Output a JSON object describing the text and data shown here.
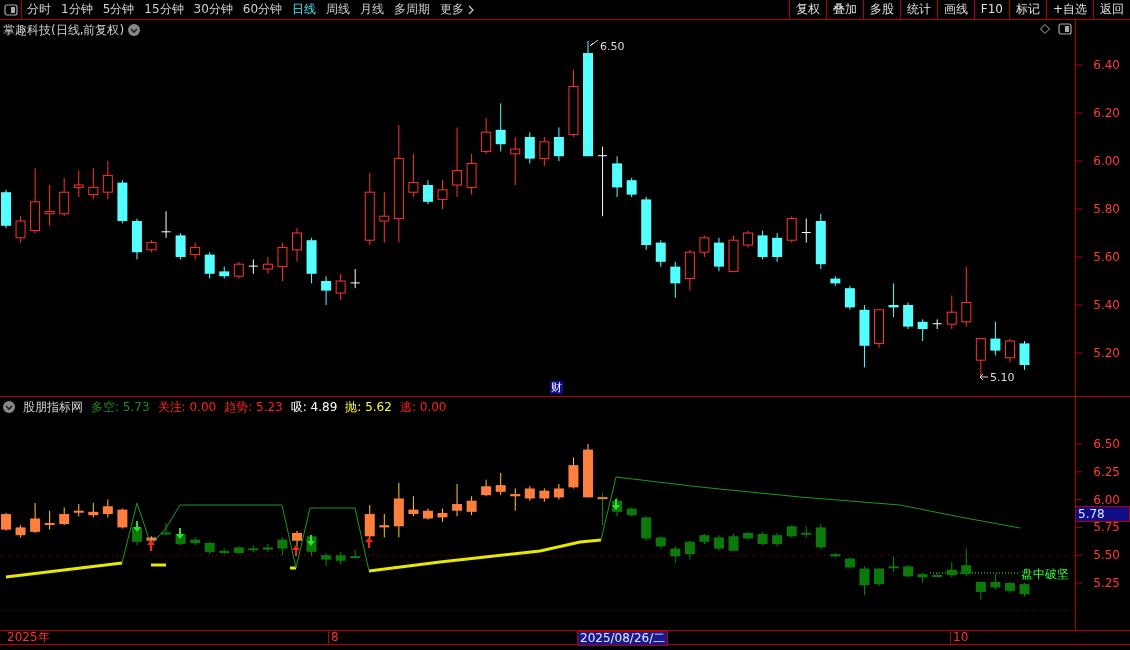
{
  "toolbar": {
    "periods": [
      {
        "label": "分时",
        "selected": false
      },
      {
        "label": "1分钟",
        "selected": false
      },
      {
        "label": "5分钟",
        "selected": false
      },
      {
        "label": "15分钟",
        "selected": false
      },
      {
        "label": "30分钟",
        "selected": false
      },
      {
        "label": "60分钟",
        "selected": false
      },
      {
        "label": "日线",
        "selected": true
      },
      {
        "label": "周线",
        "selected": false
      },
      {
        "label": "月线",
        "selected": false
      },
      {
        "label": "多周期",
        "selected": false
      },
      {
        "label": "更多",
        "selected": false
      }
    ],
    "actions": [
      "复权",
      "叠加",
      "多股",
      "统计",
      "画线",
      "F10",
      "标记",
      "+自选",
      "返回"
    ]
  },
  "main_chart": {
    "title": "掌趣科技(日线,前复权)",
    "high_label": "6.50",
    "low_label": "5.10",
    "event_marker": "财",
    "y_ticks": [
      "6.40",
      "6.20",
      "6.00",
      "5.80",
      "5.60",
      "5.40",
      "5.20"
    ]
  },
  "indicator": {
    "name": "股朋指标网",
    "values": [
      {
        "text": "多空: 5.73",
        "color": "#1e8c1e"
      },
      {
        "text": "关注: 0.00",
        "color": "#ff2020"
      },
      {
        "text": "趋势: 5.23",
        "color": "#ff2020"
      },
      {
        "text": "吸: 4.89",
        "color": "#ffffff"
      },
      {
        "text": "抛: 5.62",
        "color": "#ffff33"
      },
      {
        "text": "逃: 0.00",
        "color": "#ff2020"
      }
    ],
    "signal_text": "盘中破坚",
    "current_price": "5.78",
    "y_ticks": [
      "6.50",
      "6.25",
      "6.00",
      "5.75",
      "5.50",
      "5.25"
    ]
  },
  "time_axis": {
    "labels": [
      {
        "text": "2025年",
        "selected": false
      },
      {
        "text": "8",
        "selected": false
      },
      {
        "text": "2025/08/26/二",
        "selected": true
      },
      {
        "text": "10",
        "selected": false
      }
    ]
  }
}
